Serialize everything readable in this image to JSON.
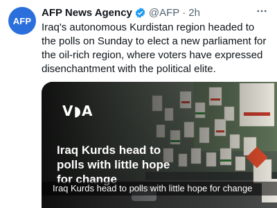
{
  "post": {
    "avatar_text": "AFP",
    "author_name": "AFP News Agency",
    "handle": "@AFP",
    "separator": "·",
    "time": "2h",
    "text": "Iraq's autonomous Kurdistan region headed to the polls on Sunday to elect a new parliament for the oil-rich region, where voters have expressed disenchantment with the political elite."
  },
  "media": {
    "logo_text": "V◗A",
    "headline": "Iraq Kurds head to polls with little hope for change",
    "caption": "Iraq Kurds head to polls with little hope for change"
  },
  "icons": {
    "verified": "verified-badge-icon",
    "more": "more-options-icon"
  },
  "colors": {
    "avatar_bg": "#2a6fdb",
    "verified": "#1d9bf0",
    "secondary_text": "#536471"
  }
}
